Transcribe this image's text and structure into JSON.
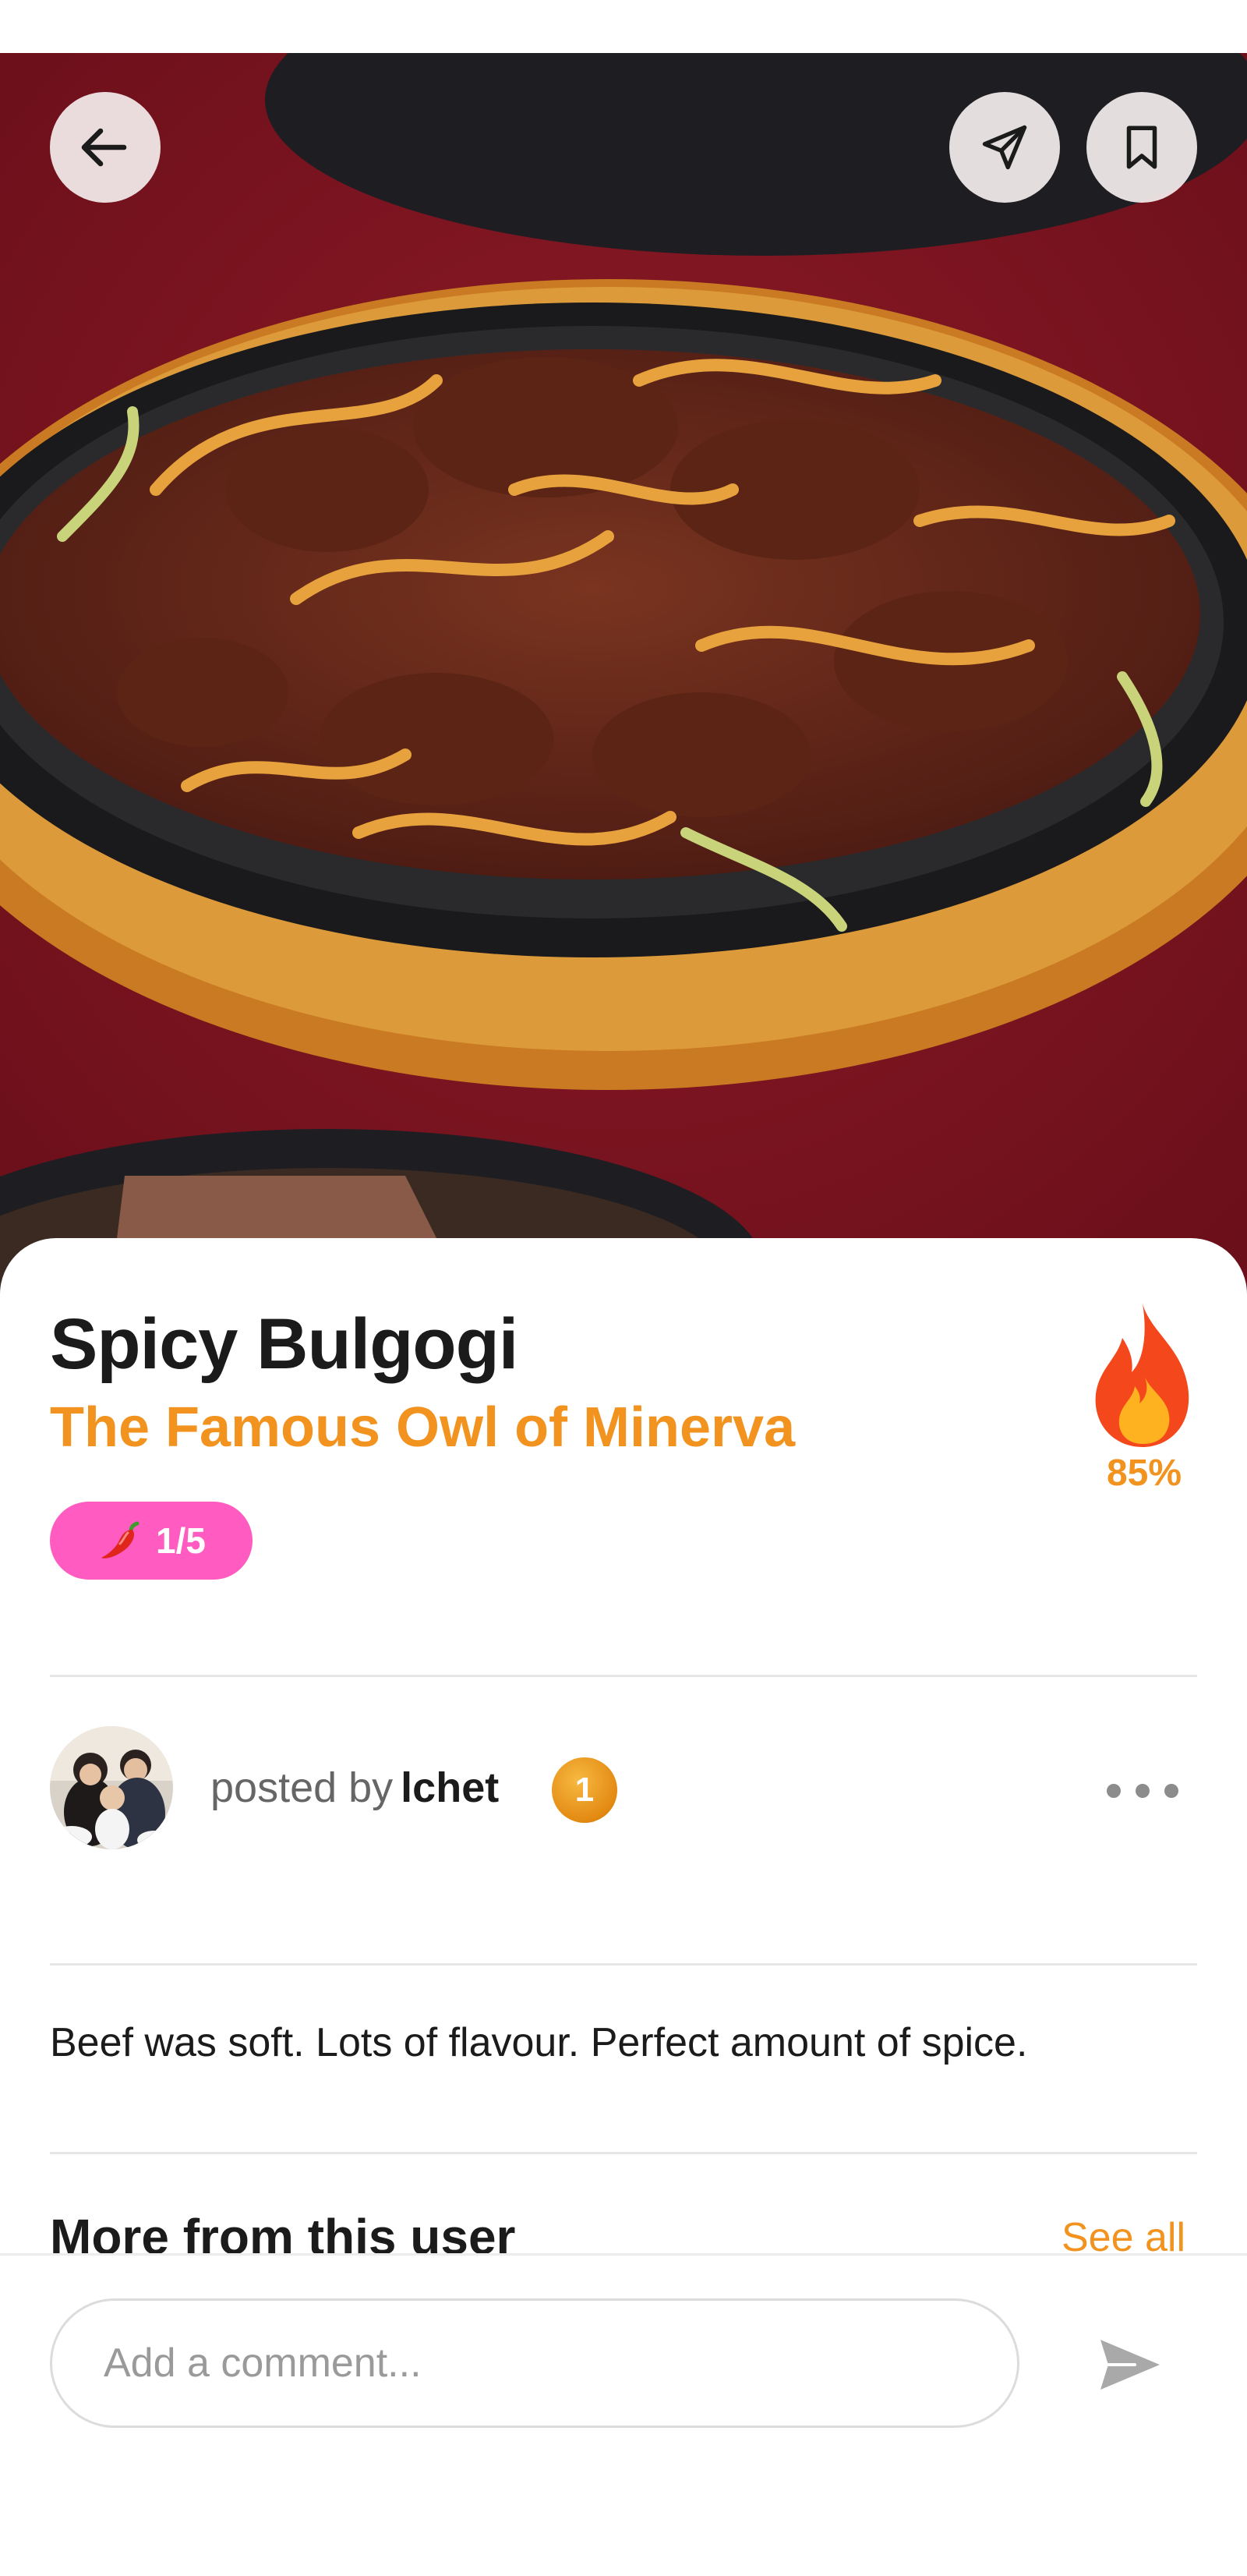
{
  "photo": {
    "alt": "Spicy Bulgogi photo",
    "icon": "food-photo"
  },
  "top_actions": {
    "back_icon": "arrow-left-icon",
    "share_icon": "send-icon",
    "bookmark_icon": "bookmark-icon"
  },
  "dish": {
    "name": "Spicy Bulgogi",
    "restaurant": "The Famous Owl of Minerva",
    "spice_level": "1/5",
    "spice_icon": "chili-pepper-icon",
    "heat_score": "85%",
    "heat_icon": "fire-icon"
  },
  "post": {
    "posted_by_label": "posted by",
    "username": "lchet",
    "user_level": "1",
    "more_icon": "more-horizontal-icon"
  },
  "review": {
    "text": "Beef was soft. Lots of flavour. Perfect amount of spice."
  },
  "more_section": {
    "title": "More from this user",
    "see_all": "See all"
  },
  "comment": {
    "placeholder": "Add a comment...",
    "send_icon": "send-filled-icon"
  },
  "colors": {
    "accent": "#f2931f",
    "spice_badge": "#ff5bc0",
    "level_badge": "#e8921a",
    "fire": "#f5471c"
  }
}
